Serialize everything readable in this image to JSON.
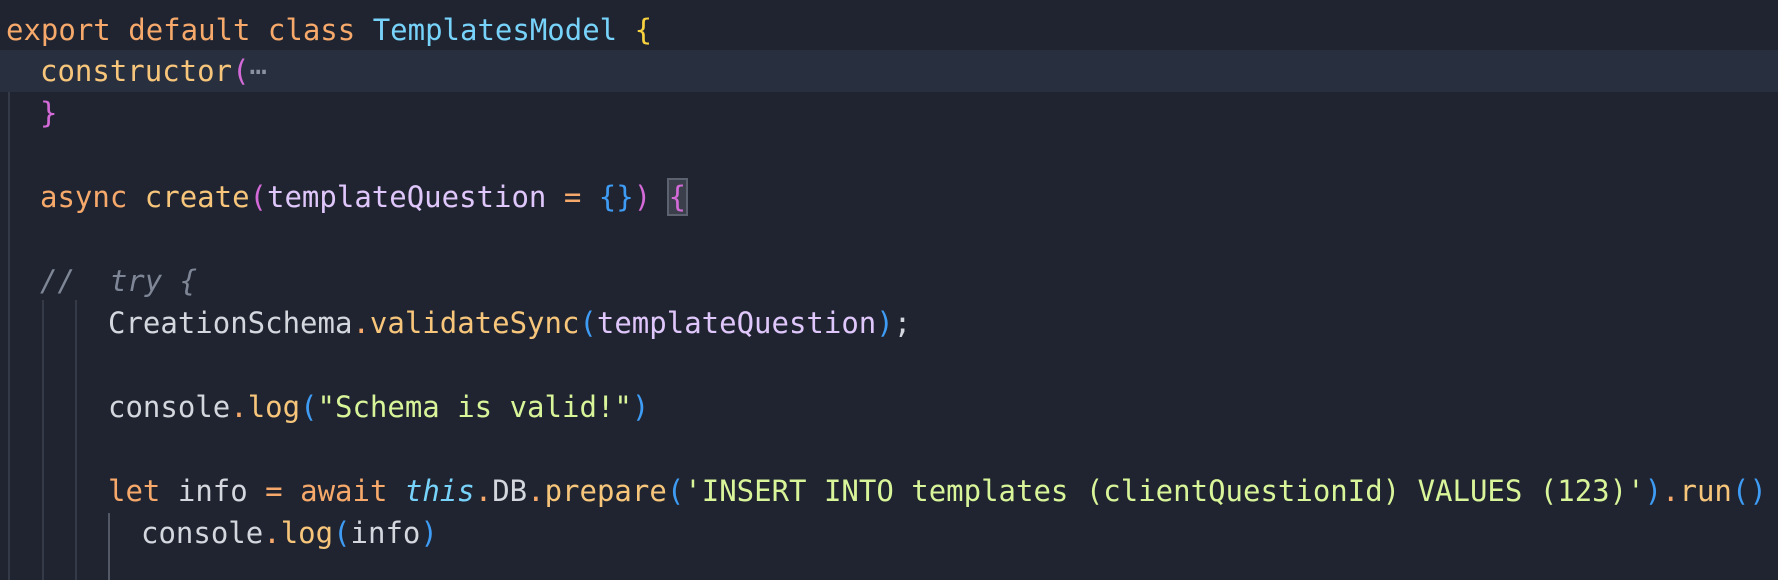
{
  "code": {
    "l1": {
      "export": "export",
      "default": "default",
      "class": "class",
      "name": "TemplatesModel",
      "brace": "{"
    },
    "l2": {
      "ctor": "constructor",
      "paren": "(",
      "fold": "⋯"
    },
    "l3": {
      "brace": "}"
    },
    "l5": {
      "async": "async",
      "fn": "create",
      "lparen": "(",
      "param": "templateQuestion",
      "eq": "=",
      "obj": "{}",
      "rparen": ")",
      "brace": "{"
    },
    "l7": {
      "comment": "//  try {"
    },
    "l8": {
      "obj": "CreationSchema",
      "dot": ".",
      "method": "validateSync",
      "lparen": "(",
      "arg": "templateQuestion",
      "rparen": ")",
      "semi": ";"
    },
    "l10": {
      "obj": "console",
      "dot": ".",
      "method": "log",
      "lparen": "(",
      "str": "\"Schema is valid!\"",
      "rparen": ")"
    },
    "l12": {
      "let": "let",
      "var": "info",
      "eq": "=",
      "await": "await",
      "this": "this",
      "dot1": ".",
      "db": "DB",
      "dot2": ".",
      "prepare": "prepare",
      "lparen": "(",
      "str": "'INSERT INTO templates (clientQuestionId) VALUES (123)'",
      "rparen": ")",
      "dot3": ".",
      "run": "run",
      "call": "()"
    },
    "l13": {
      "obj": "console",
      "dot": ".",
      "method": "log",
      "lparen": "(",
      "arg": "info",
      "rparen": ")"
    }
  }
}
